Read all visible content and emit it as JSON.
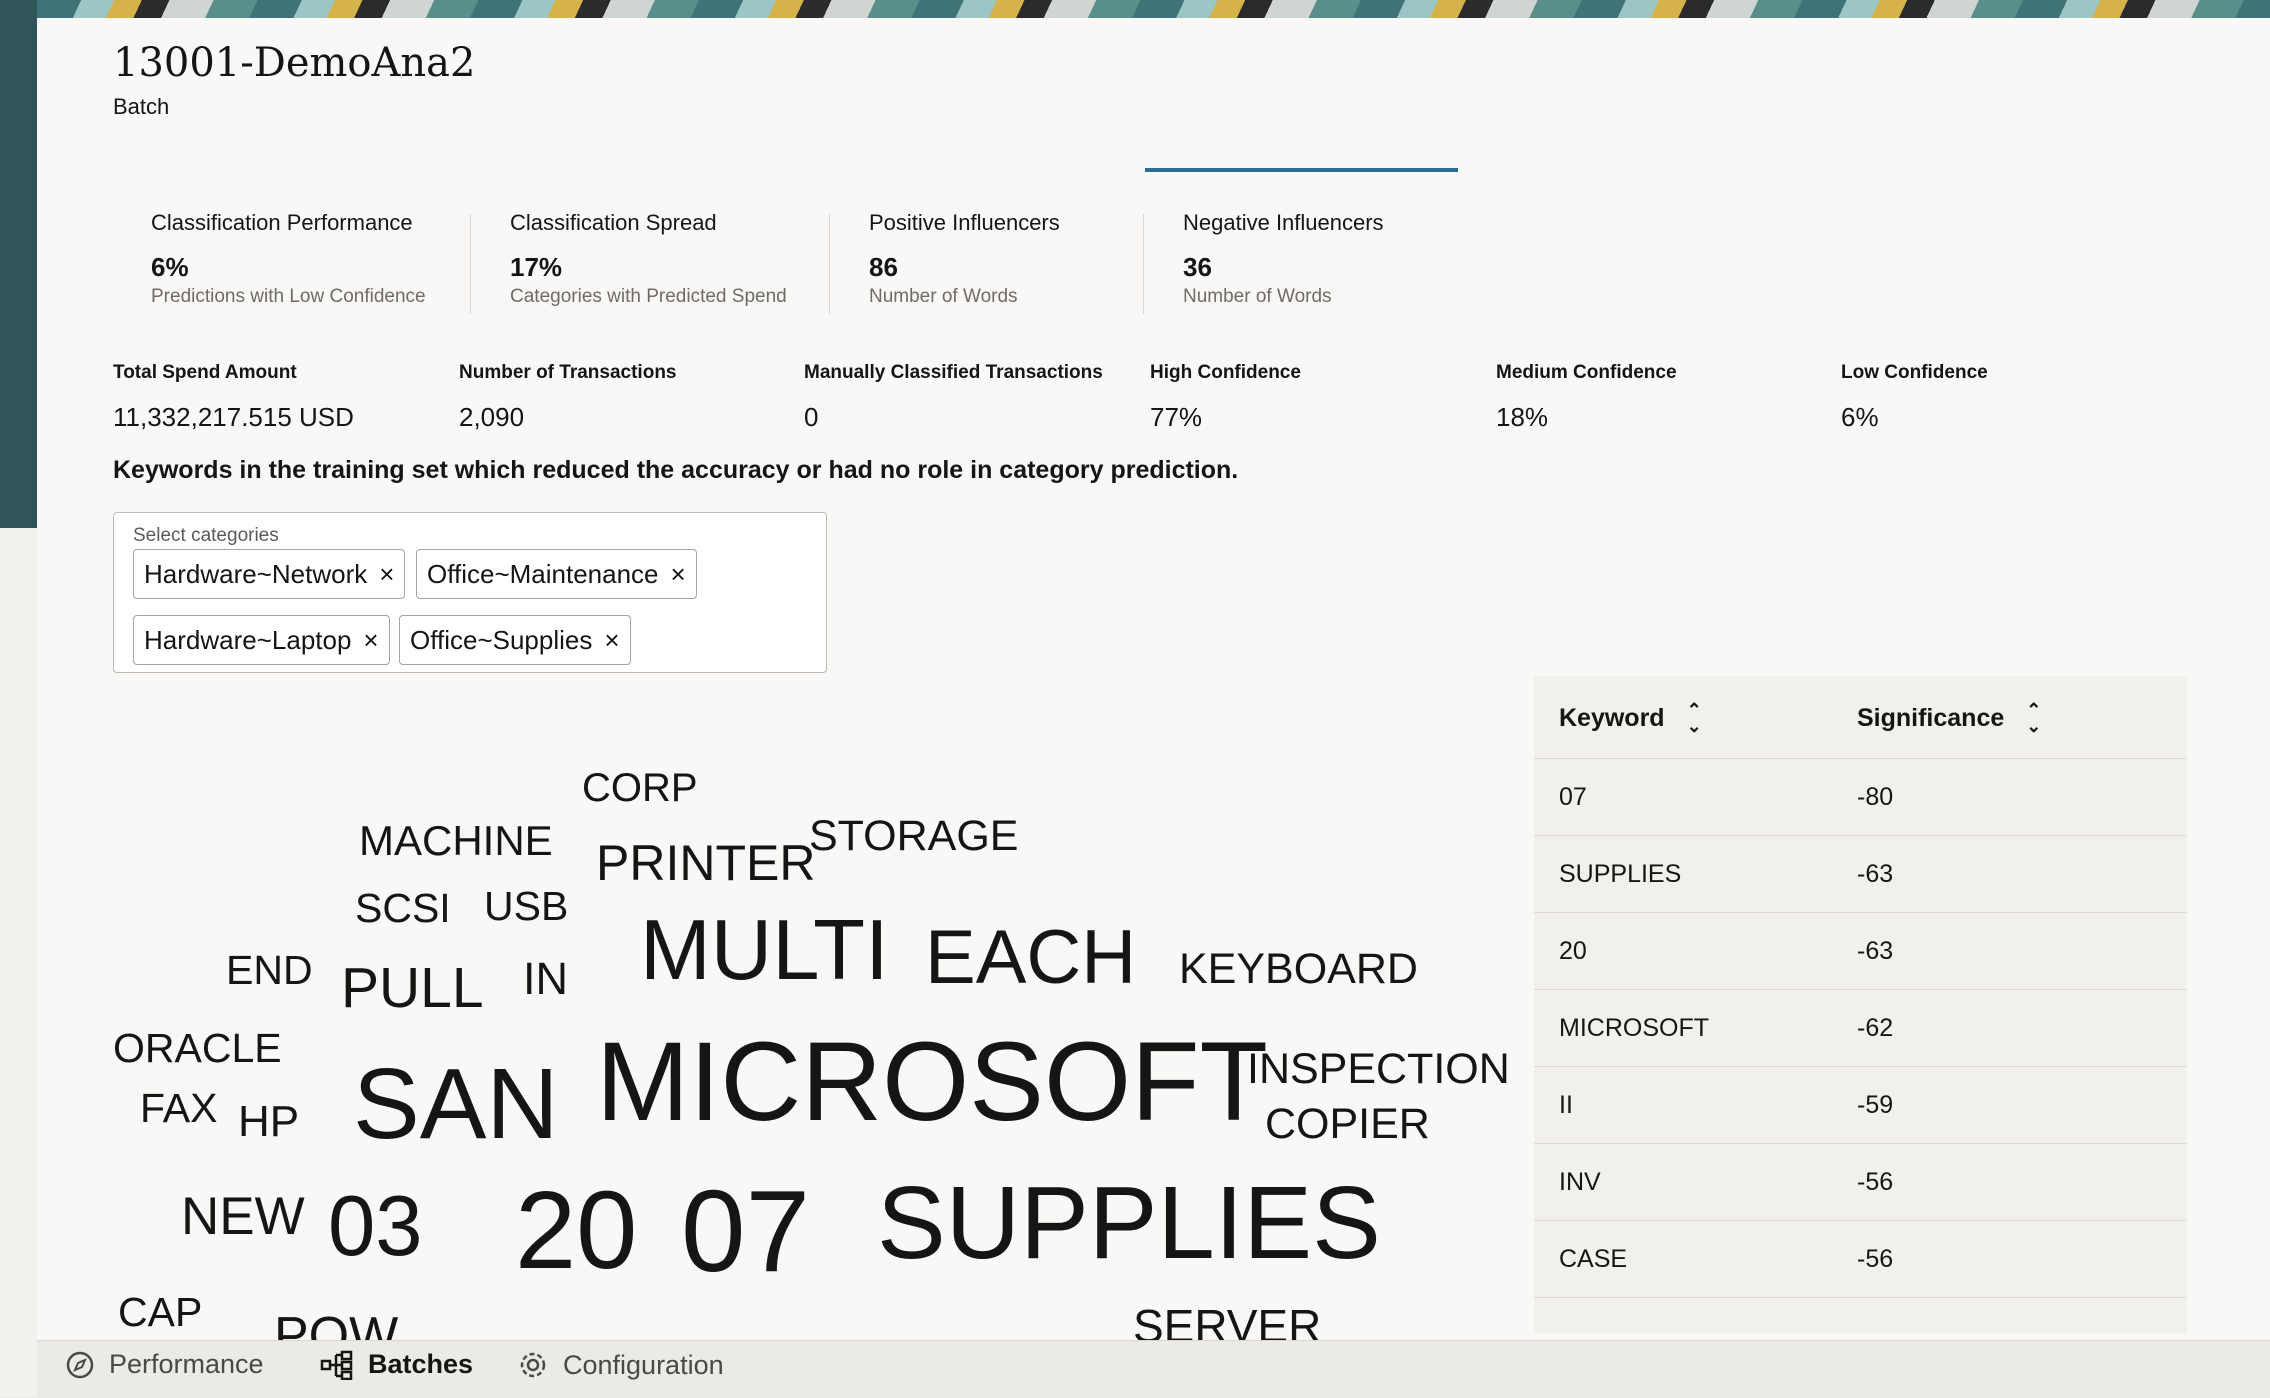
{
  "header": {
    "title": "13001-DemoAna2",
    "subtitle": "Batch"
  },
  "tabs": [
    {
      "label": "Classification Performance",
      "value": "6%",
      "desc": "Predictions with Low Confidence"
    },
    {
      "label": "Classification Spread",
      "value": "17%",
      "desc": "Categories with Predicted Spend"
    },
    {
      "label": "Positive Influencers",
      "value": "86",
      "desc": "Number of Words"
    },
    {
      "label": "Negative Influencers",
      "value": "36",
      "desc": "Number of Words"
    }
  ],
  "stats": [
    {
      "label": "Total Spend Amount",
      "value": "11,332,217.515 USD"
    },
    {
      "label": "Number of Transactions",
      "value": "2,090"
    },
    {
      "label": "Manually Classified Transactions",
      "value": "0"
    },
    {
      "label": "High Confidence",
      "value": "77%"
    },
    {
      "label": "Medium Confidence",
      "value": "18%"
    },
    {
      "label": "Low Confidence",
      "value": "6%"
    }
  ],
  "section_heading": "Keywords in the training set which reduced the accuracy or had no role in category prediction.",
  "category_select": {
    "label": "Select categories",
    "chips": [
      "Hardware~Network",
      "Office~Maintenance",
      "Hardware~Laptop",
      "Office~Supplies"
    ],
    "remove_glyph": "×"
  },
  "word_cloud": [
    "CORP",
    "MACHINE",
    "PRINTER",
    "STORAGE",
    "SCSI",
    "USB",
    "MULTI",
    "EACH",
    "KEYBOARD",
    "END",
    "PULL",
    "IN",
    "ORACLE",
    "SAN",
    "MICROSOFT",
    "INSPECTION",
    "FAX",
    "HP",
    "COPIER",
    "NEW",
    "03",
    "20",
    "07",
    "SUPPLIES",
    "CAP",
    "POW",
    "SERVER"
  ],
  "keyword_table": {
    "headers": [
      "Keyword",
      "Significance"
    ],
    "rows": [
      [
        "07",
        "-80"
      ],
      [
        "SUPPLIES",
        "-63"
      ],
      [
        "20",
        "-63"
      ],
      [
        "MICROSOFT",
        "-62"
      ],
      [
        "II",
        "-59"
      ],
      [
        "INV",
        "-56"
      ],
      [
        "CASE",
        "-56"
      ]
    ]
  },
  "footer_nav": [
    {
      "label": "Performance",
      "icon": "compass-icon"
    },
    {
      "label": "Batches",
      "icon": "hierarchy-icon"
    },
    {
      "label": "Configuration",
      "icon": "gear-icon"
    }
  ],
  "colors": {
    "active_tab": "#2b6c8f",
    "panel_bg": "#f9f8f6",
    "text": "#161513"
  }
}
